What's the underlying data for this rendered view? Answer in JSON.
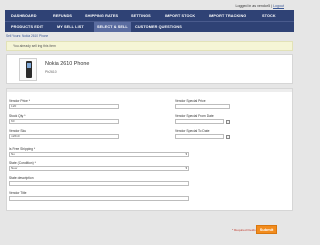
{
  "header": {
    "login_text": "Logged in as vendor5 |",
    "logout_label": "Logout"
  },
  "nav": {
    "row1": [
      "DASHBOARD",
      "REFUNDS",
      "SHIPPING RATES",
      "SETTINGS",
      "IMPORT STOCK",
      "IMPORT TRACKING",
      "STOCK"
    ],
    "row2": [
      "PRODUCTS EDIT",
      "MY SELL LIST",
      "SELECT & SELL",
      "CUSTOMER QUESTIONS"
    ],
    "active": "SELECT & SELL"
  },
  "breadcrumb": "Sell Yours: Nokia 2610 Phone",
  "notice": "You already sell ing this item",
  "product": {
    "name": "Nokia 2610 Phone",
    "sku": "Ph2610"
  },
  "form": {
    "vendor_price": {
      "label": "Vendor Price *",
      "value": "120"
    },
    "stock_qty": {
      "label": "Stock Qty *",
      "value": "60"
    },
    "vendor_sku": {
      "label": "Vendor Sku",
      "value": "n2610"
    },
    "free_shipping": {
      "label": "Is Free Shipping *",
      "value": "No"
    },
    "state_condition": {
      "label": "State (Condition) *",
      "value": "New"
    },
    "state_description": {
      "label": "State description",
      "value": ""
    },
    "vendor_title": {
      "label": "Vendor Title",
      "value": ""
    },
    "special_price": {
      "label": "Vendor Special Price",
      "value": ""
    },
    "special_from": {
      "label": "Vendor Special From Date",
      "value": ""
    },
    "special_to": {
      "label": "Vendor Special To Date",
      "value": ""
    }
  },
  "footer": {
    "required_note": "* Required Fields",
    "submit_label": "Submit"
  },
  "colors": {
    "nav_bg": "#2f4275",
    "accent": "#f28c1e",
    "notice_bg": "#f5f5d6"
  }
}
